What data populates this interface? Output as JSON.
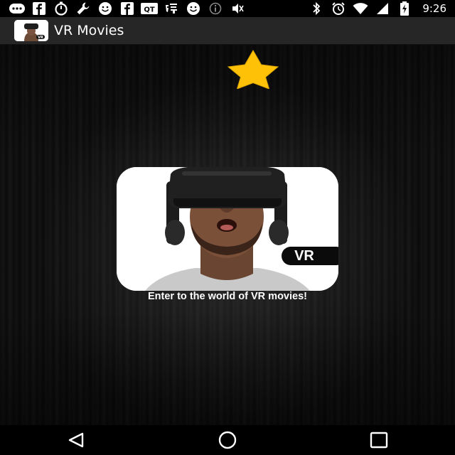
{
  "status_bar": {
    "time": "9:26",
    "left_icons": [
      "chat-bubble-icon",
      "facebook-icon",
      "timer-icon",
      "wrench-icon",
      "smiley-icon",
      "facebook-icon",
      "qt-icon",
      "taobao-icon",
      "smiley-icon",
      "info-icon",
      "mute-icon"
    ],
    "left_labels": {
      "qt": "QT"
    },
    "right_icons": [
      "bluetooth-icon",
      "alarm-icon",
      "wifi-icon",
      "signal-icon",
      "battery-charging-icon"
    ]
  },
  "app_bar": {
    "title": "VR Movies",
    "logo": "vr-headset-logo"
  },
  "main": {
    "star_icon": "star-icon",
    "star_color": "#FFC107",
    "hero_image": "vr-headset-man",
    "hero_badge": "VR",
    "caption": "Enter to the world of VR movies!"
  },
  "nav_bar": {
    "buttons": [
      "back-icon",
      "home-icon",
      "recents-icon"
    ]
  }
}
